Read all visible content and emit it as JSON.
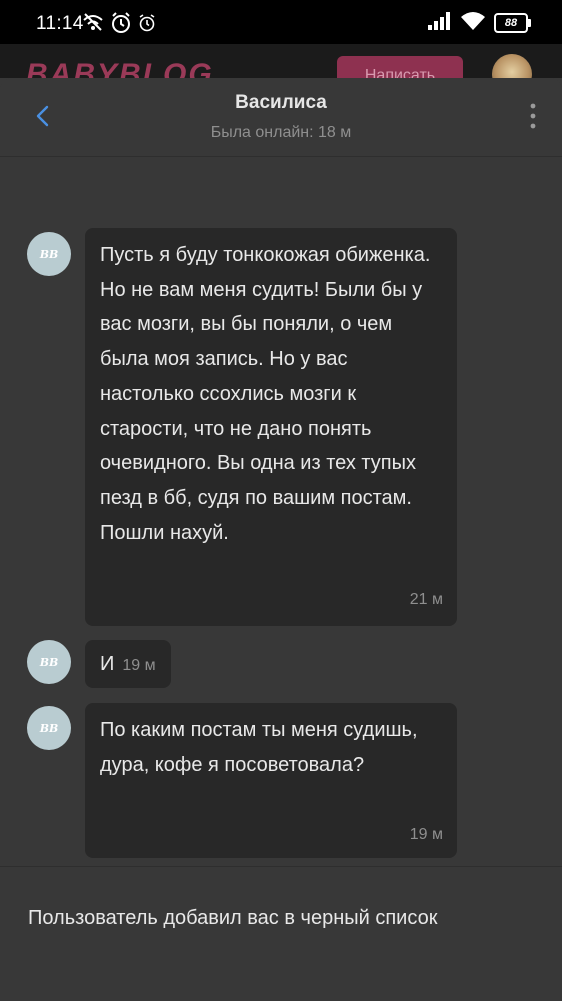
{
  "status_bar": {
    "time": "11:14",
    "battery": "88",
    "icons": [
      "wifi-off-icon",
      "alarm-icon",
      "alarm-small-icon",
      "signal-icon",
      "wifi-icon",
      "battery-icon"
    ]
  },
  "background_page": {
    "logo": "BABYBLOG",
    "write_button": "Написать"
  },
  "header": {
    "title": "Василиса",
    "subtitle": "Была онлайн: 18 м"
  },
  "avatar_text": "BB",
  "messages": [
    {
      "text": "Пусть я буду тонкокожая обиженка. Но не вам меня судить! Были бы у вас мозги, вы бы поняли, о чем была моя запись. Но у вас настолько ссохлись мозги к старости, что не дано понять очевидного. Вы одна из тех тупых пезд в бб, судя по вашим постам. Пошли нахуй.",
      "time": "21 м"
    },
    {
      "text": "И",
      "time": "19 м"
    },
    {
      "text": "По каким постам ты меня судишь, дура, кофе я посоветовала?",
      "time": "19 м"
    }
  ],
  "footer": {
    "notice": "Пользователь добавил вас в черный список"
  },
  "colors": {
    "background": "#383838",
    "bubble": "#282828",
    "accent": "#4a90e2",
    "avatar": "#b9ccd1",
    "muted": "#8f8f8f"
  }
}
